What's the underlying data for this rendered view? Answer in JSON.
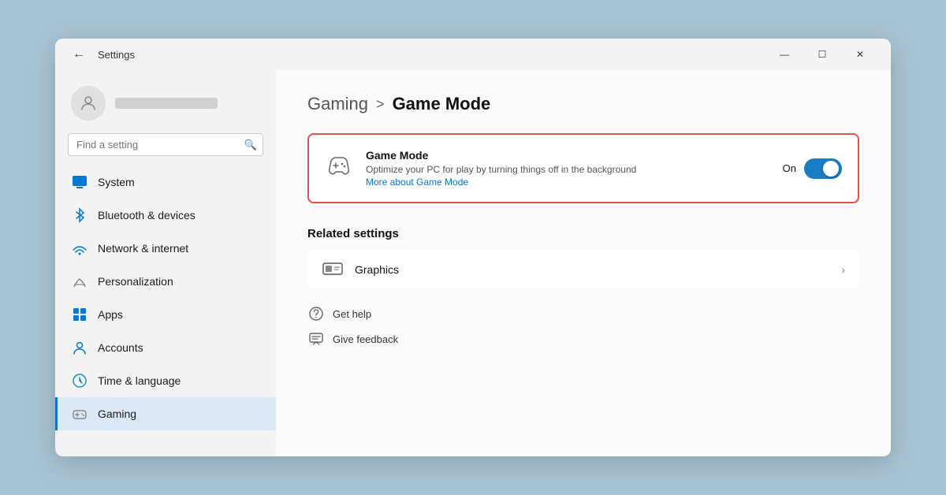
{
  "window": {
    "title": "Settings",
    "minimize_label": "—",
    "maximize_label": "☐",
    "close_label": "✕"
  },
  "sidebar": {
    "search_placeholder": "Find a setting",
    "nav_items": [
      {
        "id": "system",
        "label": "System",
        "icon": "system"
      },
      {
        "id": "bluetooth",
        "label": "Bluetooth & devices",
        "icon": "bluetooth"
      },
      {
        "id": "network",
        "label": "Network & internet",
        "icon": "network"
      },
      {
        "id": "personalization",
        "label": "Personalization",
        "icon": "personalization"
      },
      {
        "id": "apps",
        "label": "Apps",
        "icon": "apps"
      },
      {
        "id": "accounts",
        "label": "Accounts",
        "icon": "accounts"
      },
      {
        "id": "time",
        "label": "Time & language",
        "icon": "time"
      },
      {
        "id": "gaming",
        "label": "Gaming",
        "icon": "gaming",
        "active": true
      }
    ]
  },
  "main": {
    "breadcrumb_parent": "Gaming",
    "breadcrumb_separator": ">",
    "breadcrumb_current": "Game Mode",
    "game_mode": {
      "title": "Game Mode",
      "description": "Optimize your PC for play by turning things off in the background",
      "link": "More about Game Mode",
      "toggle_label": "On",
      "toggle_on": true
    },
    "related_settings": {
      "title": "Related settings",
      "items": [
        {
          "label": "Graphics",
          "icon": "graphics"
        }
      ]
    },
    "help_links": [
      {
        "label": "Get help",
        "icon": "help"
      },
      {
        "label": "Give feedback",
        "icon": "feedback"
      }
    ]
  }
}
